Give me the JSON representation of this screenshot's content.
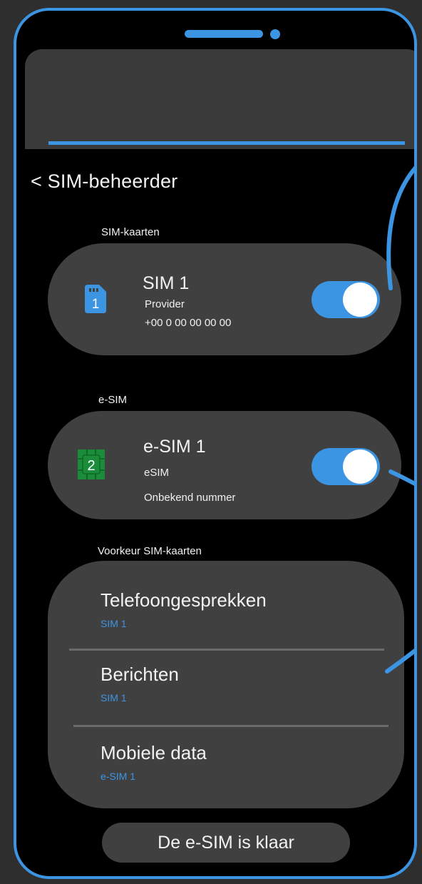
{
  "header": {
    "title": "< SIM-beheerder"
  },
  "sim_section": {
    "label": "SIM-kaarten",
    "card": {
      "icon_number": "1",
      "title": "SIM 1",
      "provider": "Provider",
      "number": "+00 0 00 00 00 00",
      "toggle_on": true
    }
  },
  "esim_section": {
    "label": "e-SIM",
    "card": {
      "icon_number": "2",
      "title": "e-SIM 1",
      "type": "eSIM",
      "number": "Onbekend nummer",
      "toggle_on": true
    }
  },
  "preferences": {
    "label": "Voorkeur SIM-kaarten",
    "items": [
      {
        "title": "Telefoongesprekken",
        "value": "SIM 1"
      },
      {
        "title": "Berichten",
        "value": "SIM 1"
      },
      {
        "title": "Mobiele data",
        "value": "e-SIM 1"
      }
    ]
  },
  "footer": {
    "ready_button": "De e-SIM is klaar"
  },
  "colors": {
    "accent": "#3c95e2",
    "card": "#404040",
    "chip": "#1a8c3a"
  }
}
